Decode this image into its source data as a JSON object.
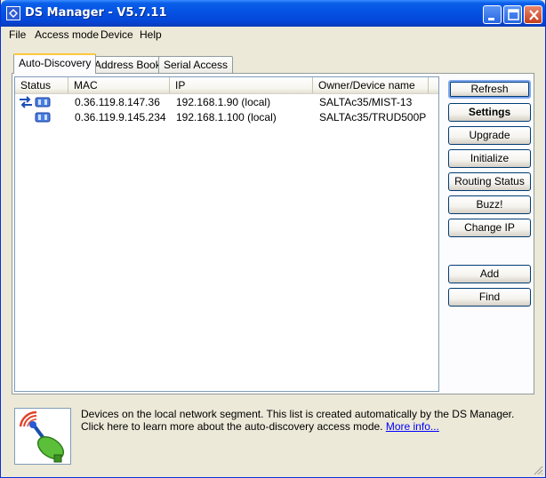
{
  "window": {
    "title": "DS Manager - V5.7.11",
    "colors": {
      "titlebar": "#0554e4",
      "face": "#ece9d8",
      "link": "#0000ff"
    }
  },
  "menu": {
    "items": [
      "File",
      "Access mode",
      "Device",
      "Help"
    ]
  },
  "tabs": [
    {
      "label": "Auto-Discovery",
      "active": true
    },
    {
      "label": "Address Book",
      "active": false
    },
    {
      "label": "Serial Access",
      "active": false
    }
  ],
  "devices": {
    "columns": [
      "Status",
      "MAC",
      "IP",
      "Owner/Device name"
    ],
    "rows": [
      {
        "status_icons": [
          "arrows-icon",
          "device-icon"
        ],
        "mac": "0.36.119.8.147.36",
        "ip": "192.168.1.90 (local)",
        "owner": "SALTAc35/MIST-13"
      },
      {
        "status_icons": [
          "device-icon"
        ],
        "mac": "0.36.119.9.145.234",
        "ip": "192.168.1.100 (local)",
        "owner": "SALTAc35/TRUD500P"
      }
    ]
  },
  "buttons": {
    "refresh": "Refresh",
    "settings": "Settings",
    "upgrade": "Upgrade",
    "initialize": "Initialize",
    "routing_status": "Routing Status",
    "buzz": "Buzz!",
    "change_ip": "Change IP",
    "add": "Add",
    "find": "Find"
  },
  "info": {
    "line1": "Devices on the local network segment. This list is created automatically by the DS Manager.",
    "line2": "Click here to learn more about the auto-discovery access mode.",
    "link": "More info..."
  }
}
